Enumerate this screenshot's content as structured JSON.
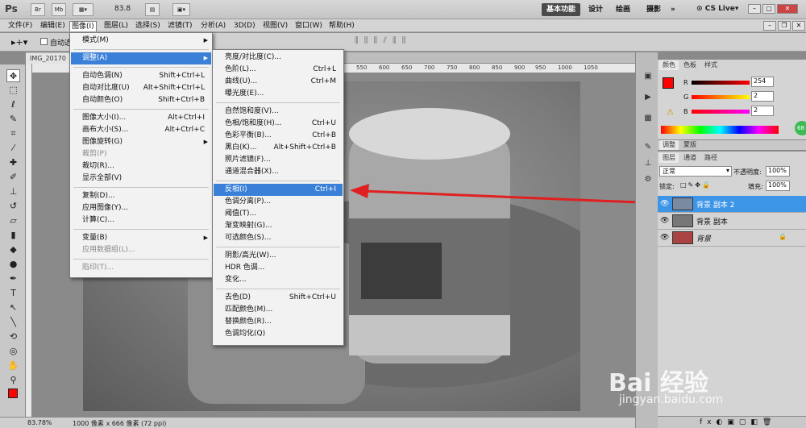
{
  "app": {
    "logo": "Ps",
    "zoom": "83.8",
    "br": "Br",
    "mb": "Mb"
  },
  "workspaces": [
    "基本功能",
    "设计",
    "绘画",
    "摄影",
    "»"
  ],
  "cslive": "CS Live",
  "menubar": [
    "文件(F)",
    "编辑(E)",
    "图像(I)",
    "图层(L)",
    "选择(S)",
    "滤镜(T)",
    "分析(A)",
    "3D(D)",
    "视图(V)",
    "窗口(W)",
    "帮助(H)"
  ],
  "optbar": {
    "auto_select": "自动选"
  },
  "doc_tab": "IMG_20170",
  "ruler_ticks": [
    "550",
    "600",
    "650",
    "700",
    "750",
    "800",
    "850",
    "900",
    "950",
    "1000",
    "1050"
  ],
  "status": {
    "zoom": "83.78%",
    "info": "1000 像素 x 666 像素 (72 ppi)"
  },
  "image_menu": [
    {
      "label": "模式(M)",
      "sc": "",
      "sub": true
    },
    {
      "sep": true
    },
    {
      "label": "调整(A)",
      "sc": "",
      "sub": true,
      "hl": true
    },
    {
      "sep": true
    },
    {
      "label": "自动色调(N)",
      "sc": "Shift+Ctrl+L"
    },
    {
      "label": "自动对比度(U)",
      "sc": "Alt+Shift+Ctrl+L"
    },
    {
      "label": "自动颜色(O)",
      "sc": "Shift+Ctrl+B"
    },
    {
      "sep": true
    },
    {
      "label": "图像大小(I)...",
      "sc": "Alt+Ctrl+I"
    },
    {
      "label": "画布大小(S)...",
      "sc": "Alt+Ctrl+C"
    },
    {
      "label": "图像旋转(G)",
      "sc": "",
      "sub": true
    },
    {
      "label": "裁剪(P)",
      "sc": "",
      "dis": true
    },
    {
      "label": "裁切(R)...",
      "sc": ""
    },
    {
      "label": "显示全部(V)",
      "sc": ""
    },
    {
      "sep": true
    },
    {
      "label": "复制(D)...",
      "sc": ""
    },
    {
      "label": "应用图像(Y)...",
      "sc": ""
    },
    {
      "label": "计算(C)...",
      "sc": ""
    },
    {
      "sep": true
    },
    {
      "label": "变量(B)",
      "sc": "",
      "sub": true
    },
    {
      "label": "应用数据组(L)...",
      "sc": "",
      "dis": true
    },
    {
      "sep": true
    },
    {
      "label": "陷印(T)...",
      "sc": "",
      "dis": true
    }
  ],
  "adjust_menu": [
    {
      "label": "亮度/对比度(C)...",
      "sc": ""
    },
    {
      "label": "色阶(L)...",
      "sc": "Ctrl+L"
    },
    {
      "label": "曲线(U)...",
      "sc": "Ctrl+M"
    },
    {
      "label": "曝光度(E)...",
      "sc": ""
    },
    {
      "sep": true
    },
    {
      "label": "自然饱和度(V)...",
      "sc": ""
    },
    {
      "label": "色相/饱和度(H)...",
      "sc": "Ctrl+U"
    },
    {
      "label": "色彩平衡(B)...",
      "sc": "Ctrl+B"
    },
    {
      "label": "黑白(K)...",
      "sc": "Alt+Shift+Ctrl+B"
    },
    {
      "label": "照片滤镜(F)...",
      "sc": ""
    },
    {
      "label": "通道混合器(X)...",
      "sc": ""
    },
    {
      "sep": true
    },
    {
      "label": "反相(I)",
      "sc": "Ctrl+I",
      "hl": true
    },
    {
      "label": "色调分离(P)...",
      "sc": ""
    },
    {
      "label": "阈值(T)...",
      "sc": ""
    },
    {
      "label": "渐变映射(G)...",
      "sc": ""
    },
    {
      "label": "可选颜色(S)...",
      "sc": ""
    },
    {
      "sep": true
    },
    {
      "label": "阴影/高光(W)...",
      "sc": ""
    },
    {
      "label": "HDR 色调...",
      "sc": ""
    },
    {
      "label": "变化...",
      "sc": ""
    },
    {
      "sep": true
    },
    {
      "label": "去色(D)",
      "sc": "Shift+Ctrl+U"
    },
    {
      "label": "匹配颜色(M)...",
      "sc": ""
    },
    {
      "label": "替换颜色(R)...",
      "sc": ""
    },
    {
      "label": "色调均化(Q)",
      "sc": ""
    }
  ],
  "color_panel": {
    "tabs": [
      "颜色",
      "色板",
      "样式"
    ],
    "r_label": "R",
    "g_label": "G",
    "b_label": "B",
    "r": "254",
    "g": "2",
    "b": "2",
    "fg": "#fe0202"
  },
  "adjust_tabs": [
    "调整",
    "蒙版"
  ],
  "layers_panel": {
    "tabs": [
      "图层",
      "通道",
      "路径"
    ],
    "blend": "正常",
    "opacity_label": "不透明度:",
    "opacity": "100%",
    "lock_label": "锁定:",
    "fill_label": "填充:",
    "fill": "100%",
    "layers": [
      "背景 副本 2",
      "背景 副本",
      "背景"
    ]
  },
  "badge": "68",
  "watermark": {
    "brand": "Bai 经验",
    "url": "jingyan.baidu.com"
  },
  "accent": "#3a80d8",
  "arrow_color": "#e02020"
}
